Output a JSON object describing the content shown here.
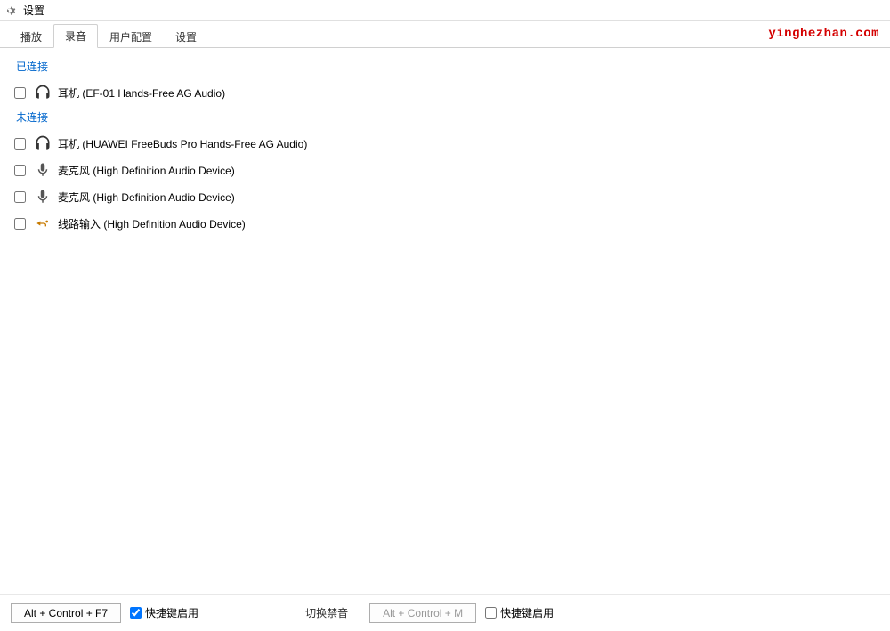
{
  "titlebar": {
    "title": "设置"
  },
  "watermark": "yinghezhan.com",
  "tabs": [
    {
      "label": "播放",
      "active": false
    },
    {
      "label": "录音",
      "active": true
    },
    {
      "label": "用户配置",
      "active": false
    },
    {
      "label": "设置",
      "active": false
    }
  ],
  "sections": {
    "connected": {
      "header": "已连接",
      "devices": [
        {
          "icon": "headphones",
          "label": "耳机 (EF-01 Hands-Free AG Audio)",
          "checked": false
        }
      ]
    },
    "disconnected": {
      "header": "未连接",
      "devices": [
        {
          "icon": "headphones",
          "label": "耳机 (HUAWEI FreeBuds Pro Hands-Free AG Audio)",
          "checked": false
        },
        {
          "icon": "microphone",
          "label": "麦克风 (High Definition Audio Device)",
          "checked": false
        },
        {
          "icon": "microphone",
          "label": "麦克风 (High Definition Audio Device)",
          "checked": false
        },
        {
          "icon": "linein",
          "label": "线路输入 (High Definition Audio Device)",
          "checked": false
        }
      ]
    }
  },
  "footer": {
    "hotkey1": "Alt + Control + F7",
    "enable1_label": "快捷键启用",
    "enable1_checked": true,
    "mute_label": "切换禁音",
    "hotkey2": "Alt + Control + M",
    "enable2_label": "快捷键启用",
    "enable2_checked": false
  }
}
